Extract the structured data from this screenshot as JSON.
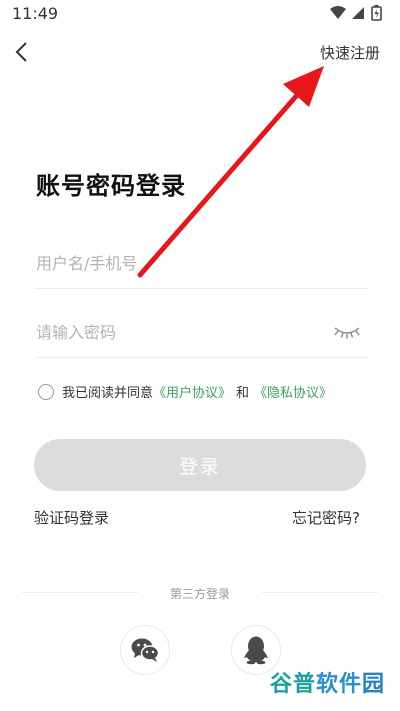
{
  "status_bar": {
    "time": "11:49"
  },
  "nav": {
    "register_label": "快速注册"
  },
  "title": "账号密码登录",
  "form": {
    "username_placeholder": "用户名/手机号",
    "password_placeholder": "请输入密码"
  },
  "agreement": {
    "prefix": "我已阅读并同意",
    "user_agreement": "《用户协议》",
    "and": "和",
    "privacy_agreement": "《隐私协议》"
  },
  "login_button": "登录",
  "links": {
    "sms_login": "验证码登录",
    "forgot_password": "忘记密码?"
  },
  "third_party": {
    "label": "第三方登录"
  },
  "watermark": {
    "part1": "谷普",
    "part2": "软件",
    "part3": "园"
  },
  "colors": {
    "accent_green": "#3aa35d",
    "arrow_red": "#e8161b",
    "button_disabled": "#dcdcdc"
  }
}
